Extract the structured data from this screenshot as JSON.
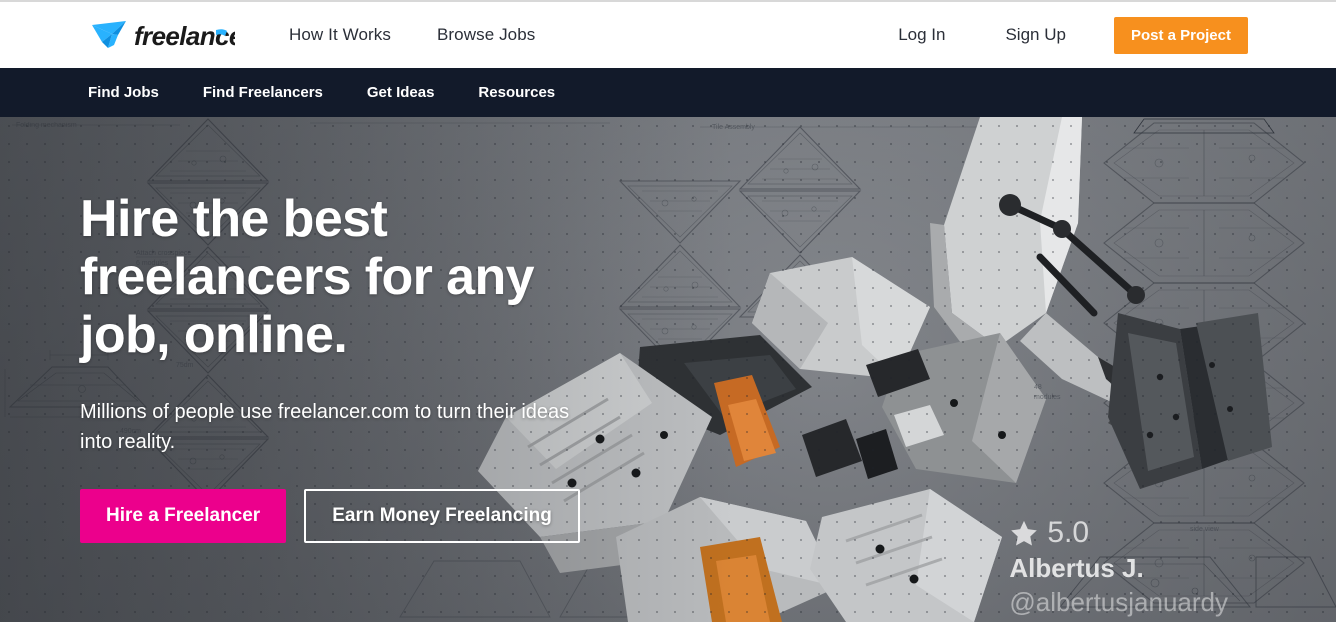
{
  "brand": {
    "name": "freelancer",
    "logo_icon": "freelancer-hummingbird-logo",
    "logo_color": "#29B2FE",
    "wordmark_color": "#1A1A1A"
  },
  "header": {
    "nav": [
      {
        "label": "How It Works"
      },
      {
        "label": "Browse Jobs"
      }
    ],
    "login_label": "Log In",
    "signup_label": "Sign Up",
    "post_project_label": "Post a Project",
    "post_project_color": "#F7901E"
  },
  "subnav": {
    "background": "#121A2A",
    "items": [
      {
        "label": "Find Jobs"
      },
      {
        "label": "Find Freelancers"
      },
      {
        "label": "Get Ideas"
      },
      {
        "label": "Resources"
      }
    ]
  },
  "hero": {
    "title": "Hire the best freelancers for any job, online.",
    "subtitle": "Millions of people use freelancer.com to turn their ideas into reality.",
    "primary_cta": "Hire a Freelancer",
    "primary_cta_color": "#EC008C",
    "secondary_cta": "Earn Money Freelancing",
    "background_description": "Photograph of a folding modular mechanical structure over a gray blueprint dot-grid"
  },
  "attribution": {
    "star_icon": "star-filled-icon",
    "rating": "5.0",
    "name": "Albertus J.",
    "handle": "@albertusjanuardy"
  }
}
